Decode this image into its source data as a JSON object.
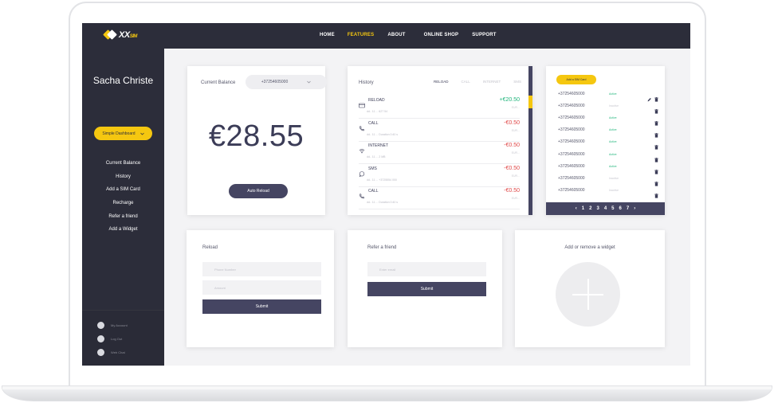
{
  "brand": {
    "logo_text": "XX",
    "logo_suffix": "SIM",
    "colors": {
      "accent": "#f5c710",
      "dark": "#2c2d3a",
      "button": "#454562",
      "positive": "#21b57c",
      "negative": "#e04848"
    }
  },
  "nav": [
    "HOME",
    "FEATURES",
    "ABOUT",
    "ONLINE SHOP",
    "SUPPORT"
  ],
  "sidebar": {
    "user_name": "Sacha Christe",
    "dashboard_button": "Simple Dashboard",
    "links": [
      "Current Balance",
      "History",
      "Add a SIM Card",
      "Recharge",
      "Refer a friend",
      "Add a Widget"
    ],
    "footer": [
      "My Account",
      "Log Out",
      "Web Chat"
    ]
  },
  "balance": {
    "label": "Current Balance",
    "phone": "+37254605000",
    "amount": "€28.55",
    "auto_reload": "Auto Reload"
  },
  "history": {
    "title": "History",
    "tabs": [
      "RELOAD",
      "CALL",
      "INTERNET",
      "SMS"
    ],
    "rows": [
      {
        "type": "RELOAD",
        "icon": "card-icon",
        "detail": "dd.. 11 ... 627 54",
        "amount": "+€20.50",
        "sign": "pos",
        "region": "EUR..."
      },
      {
        "type": "CALL",
        "icon": "phone-icon",
        "detail": "dd.. 11 ... Duration 0:40 s",
        "amount": "-€0.50",
        "sign": "neg",
        "region": "EUR..."
      },
      {
        "type": "INTERNET",
        "icon": "wifi-icon",
        "detail": "dd.. 11 ... 2 MB",
        "amount": "-€0.50",
        "sign": "neg",
        "region": "EUR..."
      },
      {
        "type": "SMS",
        "icon": "chat-icon",
        "detail": "dd.. 11 ... +3725554 000",
        "amount": "-€0.50",
        "sign": "neg",
        "region": "EUR..."
      },
      {
        "type": "CALL",
        "icon": "phone-icon",
        "detail": "dd.. 11 ... Duration 0:40 s",
        "amount": "-€0.50",
        "sign": "neg",
        "region": "EUR..."
      }
    ]
  },
  "numbers": {
    "add_button": "Add a SIM Card",
    "rows": [
      {
        "number": "+37254605000",
        "status": "Active",
        "state": "on",
        "edit": true
      },
      {
        "number": "+37254605000",
        "status": "Inactive",
        "state": "off",
        "edit": false
      },
      {
        "number": "+37254605000",
        "status": "Active",
        "state": "on",
        "edit": false
      },
      {
        "number": "+37254605000",
        "status": "Active",
        "state": "on",
        "edit": false
      },
      {
        "number": "+37254605000",
        "status": "Active",
        "state": "on",
        "edit": false
      },
      {
        "number": "+37254605000",
        "status": "Active",
        "state": "on",
        "edit": false
      },
      {
        "number": "+37254605000",
        "status": "Active",
        "state": "on",
        "edit": false
      },
      {
        "number": "+37254605000",
        "status": "Inactive",
        "state": "off",
        "edit": false
      },
      {
        "number": "+37254605000",
        "status": "Inactive",
        "state": "off",
        "edit": false
      }
    ],
    "pages": [
      "1",
      "2",
      "3",
      "4",
      "5",
      "6",
      "7"
    ]
  },
  "reload": {
    "title": "Reload",
    "phone_placeholder": "Phone Number",
    "amount_placeholder": "Amount",
    "submit": "Submit"
  },
  "refer": {
    "title": "Refer a friend",
    "email_placeholder": "Enter email",
    "submit": "Submit"
  },
  "widget": {
    "title": "Add or remove a widget"
  }
}
